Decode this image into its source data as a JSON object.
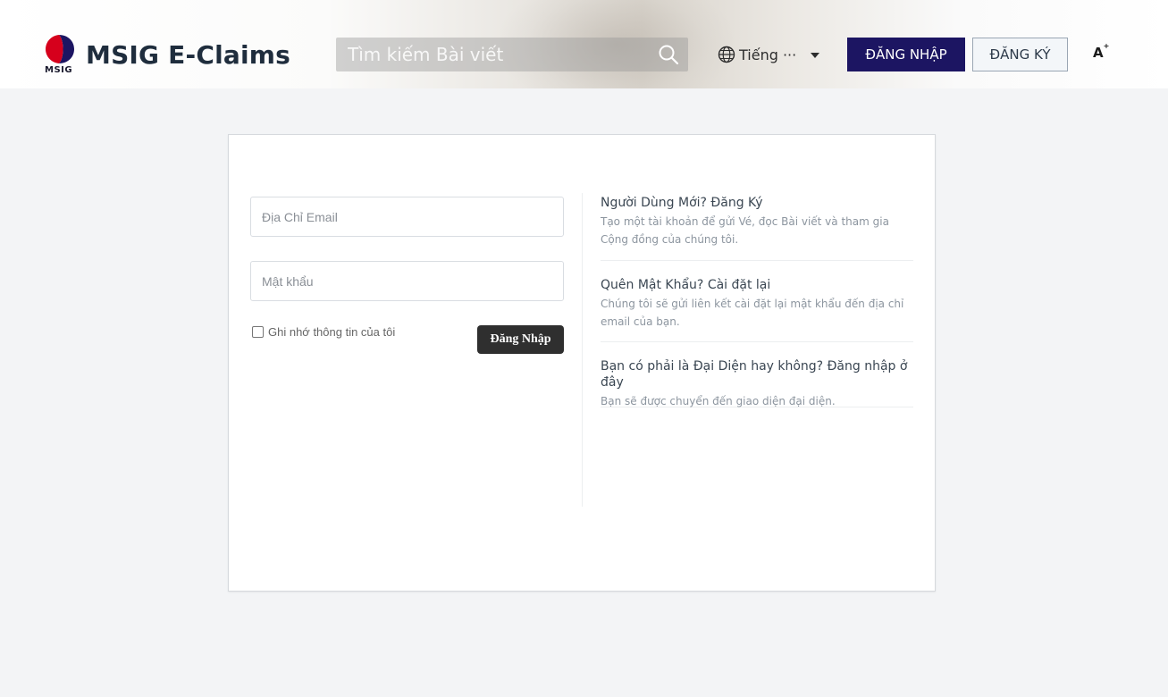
{
  "header": {
    "logo_text": "MSIG",
    "site_title": "MSIG E-Claims",
    "search_placeholder": "Tìm kiếm Bài viết",
    "language_label": "Tiếng ···",
    "login_button": "ĐĂNG NHẬP",
    "register_button": "ĐĂNG KÝ",
    "font_size_label": "A"
  },
  "login_form": {
    "email_placeholder": "Địa Chỉ Email",
    "password_placeholder": "Mật khẩu",
    "remember_label": "Ghi nhớ thông tin của tôi",
    "submit_label": "Đăng Nhập"
  },
  "info_items": [
    {
      "title": "Người Dùng Mới? Đăng Ký",
      "desc": "Tạo một tài khoản để gửi Vé, đọc Bài viết và tham gia Cộng đồng của chúng tôi."
    },
    {
      "title": "Quên Mật Khẩu? Cài đặt lại",
      "desc": "Chúng tôi sẽ gửi liên kết cài đặt lại mật khẩu đến địa chỉ email của bạn."
    },
    {
      "title": "Bạn có phải là Đại Diện hay không? Đăng nhập ở đây",
      "desc": "Bạn sẽ được chuyển đến giao diện đại diện."
    }
  ],
  "colors": {
    "brand_navy": "#1c1562",
    "logo_red": "#d6001c",
    "submit_dark": "#2f2f2f",
    "page_bg": "#f3f4f6"
  }
}
